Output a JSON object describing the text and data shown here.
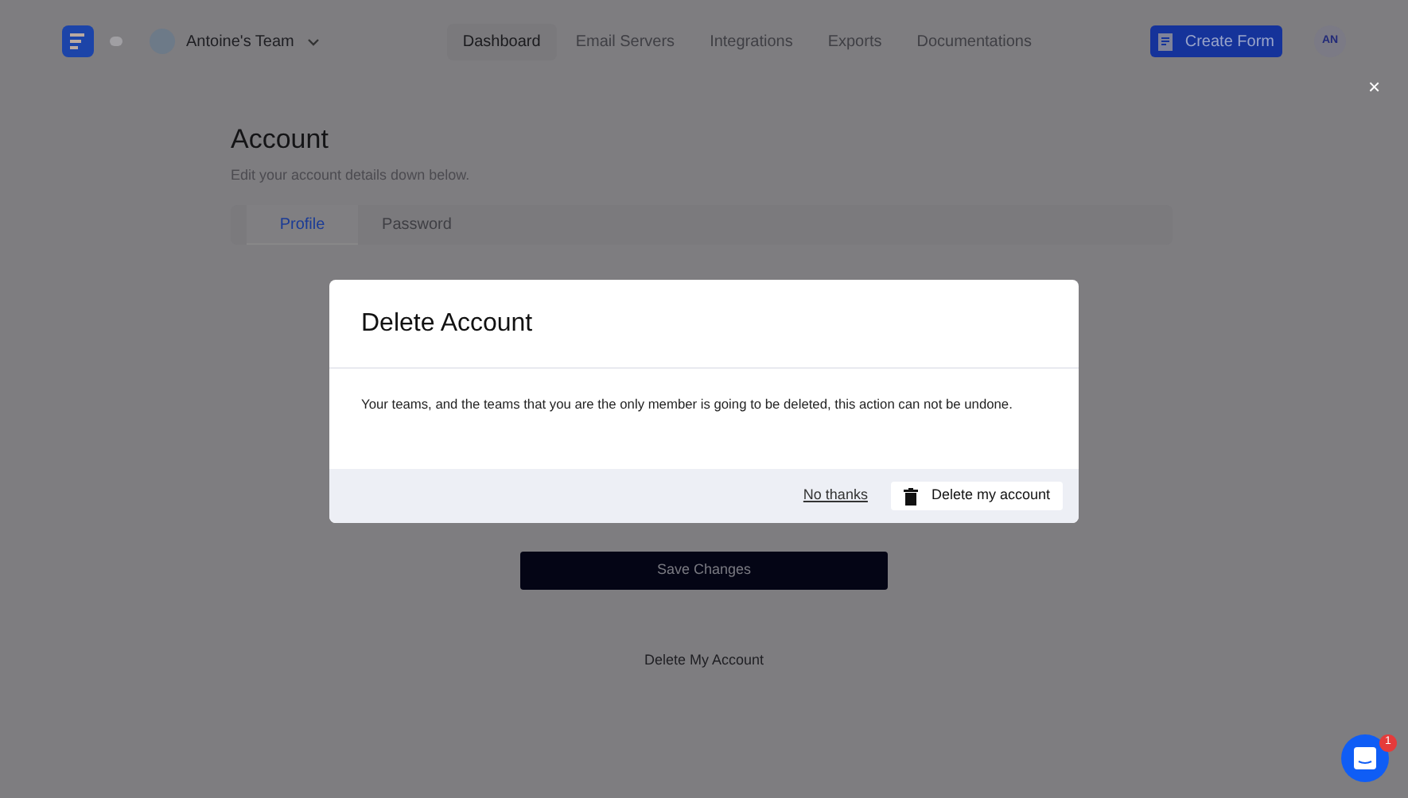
{
  "header": {
    "team": "Antoine's Team",
    "nav": [
      {
        "label": "Dashboard",
        "selected": true
      },
      {
        "label": "Email Servers",
        "selected": false
      },
      {
        "label": "Integrations",
        "selected": false
      },
      {
        "label": "Exports",
        "selected": false
      },
      {
        "label": "Documentations",
        "selected": false
      }
    ],
    "create_button": "Create Form",
    "avatar": "AN"
  },
  "close": "×",
  "page": {
    "title": "Account",
    "subtitle": "Edit your account details down below.",
    "tabs": [
      {
        "label": "Profile",
        "selected": true
      },
      {
        "label": "Password",
        "selected": false
      }
    ],
    "save_button": "Save Changes",
    "delete_link": "Delete My Account"
  },
  "dialog": {
    "title": "Delete Account",
    "message": "Your teams, and the teams that you are the only member is going to be deleted, this action can not be undone.",
    "cancel": "No thanks",
    "confirm": "Delete my account"
  },
  "chat": {
    "badge": "1"
  }
}
